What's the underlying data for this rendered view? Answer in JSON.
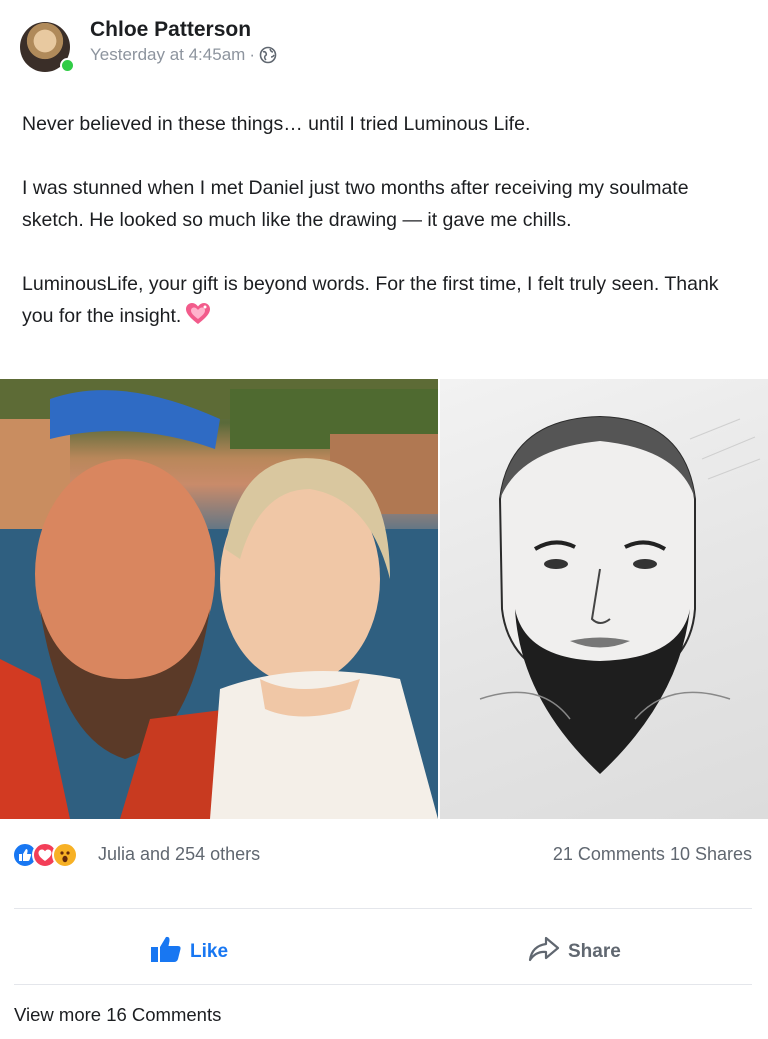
{
  "post": {
    "author": "Chloe Patterson",
    "timestamp": "Yesterday at 4:45am",
    "separator": "·",
    "privacy_icon": "globe-icon",
    "paragraphs": [
      "Never believed in these things… until I tried Luminous Life.",
      "I was stunned when I met Daniel just two months after receiving my soulmate sketch. He looked so much like the drawing — it gave me chills.",
      "LuminousLife, your gift is beyond words. For the first time, I felt truly seen. Thank you for the insight."
    ],
    "emoji": "sparkling-heart-icon"
  },
  "engagement": {
    "reaction_icons": [
      "like-reaction-icon",
      "love-reaction-icon",
      "wow-reaction-icon"
    ],
    "reactors_text": "Julia and 254 others",
    "comments_text": "21 Comments",
    "shares_text": "10 Shares"
  },
  "actions": {
    "like_label": "Like",
    "share_label": "Share"
  },
  "footer": {
    "view_more_label": "View more 16 Comments"
  },
  "colors": {
    "brand_blue": "#1877f2",
    "secondary_text": "#606770",
    "online_green": "#31cc46"
  }
}
